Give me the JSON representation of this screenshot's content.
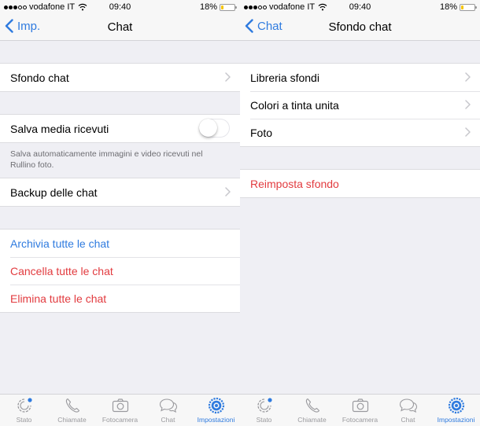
{
  "colors": {
    "accent": "#2f7bdf",
    "destructive": "#e23b3f",
    "background": "#efeff4",
    "battery": "#f5c400"
  },
  "status_bar": {
    "carrier": "vodafone IT",
    "signal_bars_filled": 3,
    "signal_bars_total": 5,
    "time": "09:40",
    "battery_percent_label": "18%",
    "battery_level": 0.18
  },
  "tab_bar": {
    "items": [
      {
        "label": "Stato",
        "icon": "status-icon"
      },
      {
        "label": "Chiamate",
        "icon": "phone-icon"
      },
      {
        "label": "Fotocamera",
        "icon": "camera-icon"
      },
      {
        "label": "Chat",
        "icon": "chat-bubbles-icon"
      },
      {
        "label": "Impostazioni",
        "icon": "settings-gear-icon",
        "active": true
      }
    ]
  },
  "screens": [
    {
      "id": "chat-settings",
      "nav": {
        "back_label": "Imp.",
        "title": "Chat"
      },
      "sections": [
        {
          "rows": [
            {
              "label": "Sfondo chat",
              "type": "disclosure"
            }
          ]
        },
        {
          "rows": [
            {
              "label": "Salva media ricevuti",
              "type": "toggle",
              "value": false
            }
          ],
          "footer": "Salva automaticamente immagini e video ricevuti nel Rullino foto."
        },
        {
          "rows": [
            {
              "label": "Backup delle chat",
              "type": "disclosure"
            }
          ]
        },
        {
          "rows": [
            {
              "label": "Archivia tutte le chat",
              "type": "action",
              "style": "blue"
            },
            {
              "label": "Cancella tutte le chat",
              "type": "action",
              "style": "red"
            },
            {
              "label": "Elimina tutte le chat",
              "type": "action",
              "style": "red"
            }
          ]
        }
      ]
    },
    {
      "id": "wallpaper-settings",
      "nav": {
        "back_label": "Chat",
        "title": "Sfondo chat"
      },
      "sections": [
        {
          "rows": [
            {
              "label": "Libreria sfondi",
              "type": "disclosure"
            },
            {
              "label": "Colori a tinta unita",
              "type": "disclosure"
            },
            {
              "label": "Foto",
              "type": "disclosure"
            }
          ]
        },
        {
          "rows": [
            {
              "label": "Reimposta sfondo",
              "type": "action",
              "style": "red"
            }
          ]
        }
      ]
    }
  ]
}
